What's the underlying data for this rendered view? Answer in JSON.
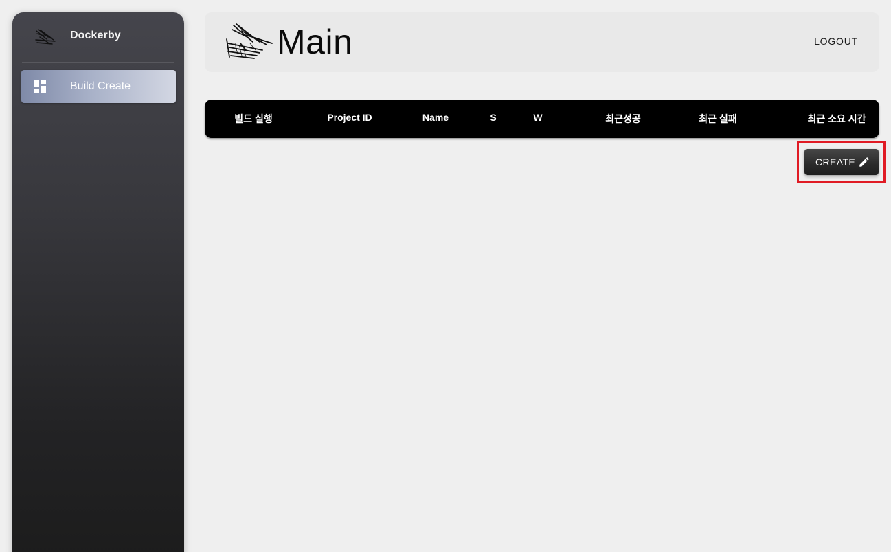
{
  "sidebar": {
    "brand_name": "Dockerby",
    "items": [
      {
        "label": "Build Create",
        "icon": "dashboard-icon",
        "active": true
      }
    ]
  },
  "header": {
    "title": "Main",
    "logout_label": "LOGOUT"
  },
  "table": {
    "columns": [
      "빌드 실행",
      "Project ID",
      "Name",
      "S",
      "W",
      "최근성공",
      "최근 실패",
      "최근 소요 시간"
    ],
    "rows": []
  },
  "actions": {
    "create_label": "CREATE",
    "create_icon": "pencil-icon"
  },
  "colors": {
    "highlight": "#e01b24",
    "table_header_bg": "#000000",
    "page_bg": "#efefef"
  }
}
